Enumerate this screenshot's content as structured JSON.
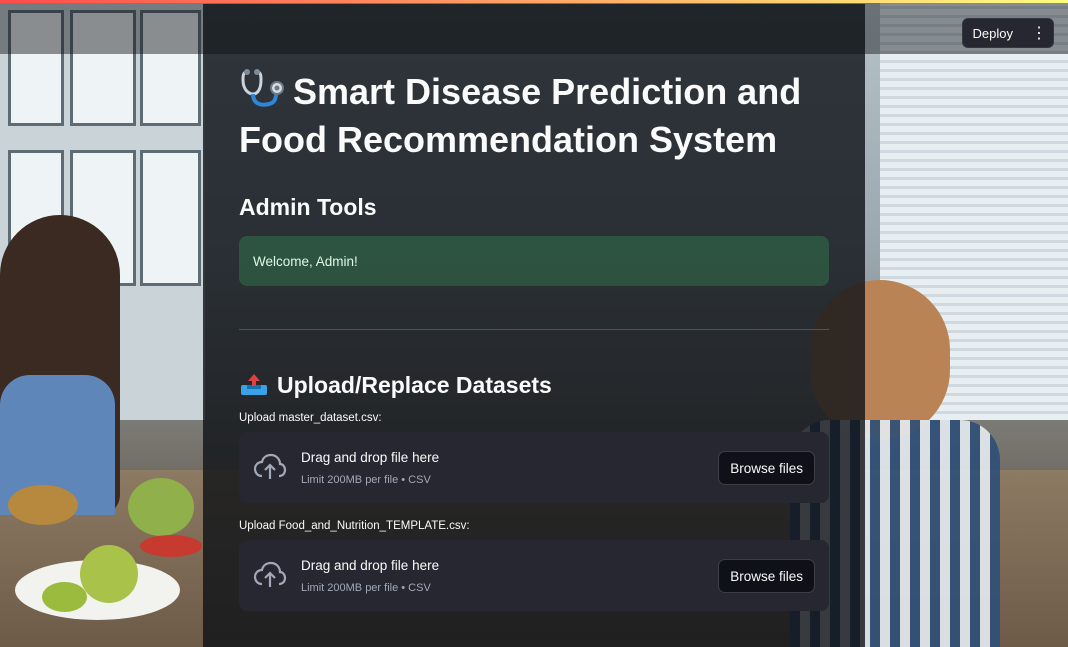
{
  "header": {
    "deploy_label": "Deploy",
    "menu_icon": "vertical-dots-icon"
  },
  "main": {
    "title": "Smart Disease Prediction and Food Recommendation System",
    "title_icon": "stethoscope-icon",
    "admin_heading": "Admin Tools",
    "success_message": "Welcome, Admin!",
    "upload_section": {
      "heading": "Upload/Replace Datasets",
      "heading_icon": "inbox-tray-icon",
      "uploaders": [
        {
          "label": "Upload master_dataset.csv:",
          "drop_text": "Drag and drop file here",
          "limit_text": "Limit 200MB per file • CSV",
          "button_label": "Browse files"
        },
        {
          "label": "Upload Food_and_Nutrition_TEMPLATE.csv:",
          "drop_text": "Drag and drop file here",
          "limit_text": "Limit 200MB per file • CSV",
          "button_label": "Browse files"
        }
      ]
    }
  },
  "colors": {
    "accent_start": "#ff4b4b",
    "accent_end": "#fffd80",
    "success_bg": "#3dd56d"
  }
}
